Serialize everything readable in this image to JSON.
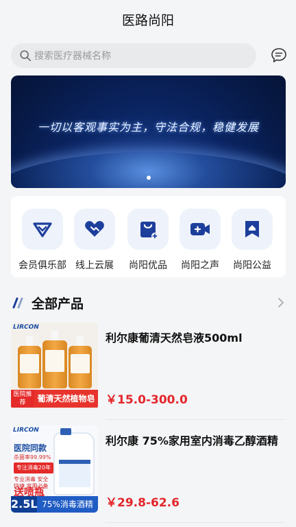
{
  "app": {
    "title": "医路尚阳"
  },
  "search": {
    "placeholder": "搜索医疗器械名称"
  },
  "banner": {
    "slogan": "一切以客观事实为主，守法合规，稳健发展"
  },
  "categories": [
    {
      "label": "会员俱乐部",
      "icon": "diamond-icon"
    },
    {
      "label": "线上云展",
      "icon": "handshake-icon"
    },
    {
      "label": "尚阳优品",
      "icon": "shopping-bag-icon"
    },
    {
      "label": "尚阳之声",
      "icon": "video-camera-icon"
    },
    {
      "label": "尚阳公益",
      "icon": "charity-home-icon"
    }
  ],
  "section": {
    "title": "全部产品"
  },
  "products": [
    {
      "name": "利尔康葡清天然皂液500ml",
      "price": "￥15.0-300.0",
      "image": {
        "brand": "LIRCON",
        "tag": "医院推荐",
        "strip": "葡清天然植物皂液"
      }
    },
    {
      "name": "利尔康 75%家用室内消毒乙醇酒精",
      "price": "￥29.8-62.6",
      "image": {
        "brand": "LIRCON",
        "headline": "医院同款",
        "rate": "杀菌率99.99%",
        "tag": "专注消毒20年",
        "small": "专业消毒 安全快捷 家用必备",
        "gift": "送喷瓶",
        "volume": "2.5L",
        "strip": "75%消毒酒精"
      }
    }
  ],
  "colors": {
    "accent": "#1f5cc4",
    "price": "#e3262a",
    "icon": "#1d3f9c"
  }
}
